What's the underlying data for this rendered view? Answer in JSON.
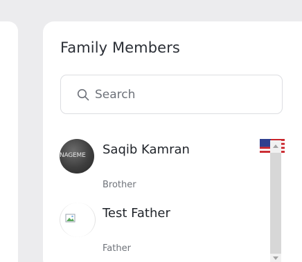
{
  "panel": {
    "title": "Family Members"
  },
  "search": {
    "placeholder": "Search",
    "value": ""
  },
  "members": [
    {
      "name": "Saqib Kamran",
      "relation": "Brother",
      "avatar_text": "ANAGEME",
      "flag": "us-flag-icon"
    },
    {
      "name": "Test Father",
      "relation": "Father",
      "avatar_text": ""
    }
  ],
  "colors": {
    "background": "#ececee",
    "card": "#ffffff",
    "title": "#2b2f36",
    "muted": "#6f737a"
  }
}
